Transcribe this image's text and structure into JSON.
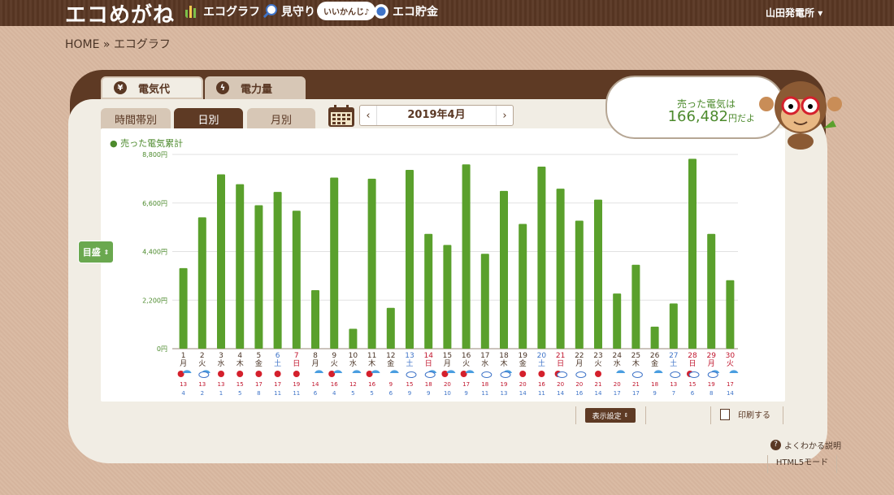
{
  "header": {
    "logo": "エコめがね",
    "nav": [
      {
        "label": "エコグラフ",
        "icon": "bar-chart-icon"
      },
      {
        "label": "見守り",
        "icon": "magnifier-icon"
      },
      {
        "label": "エコ貯金",
        "icon": "coin-icon"
      }
    ],
    "status_bubble": "いいかんじ♪",
    "user": "山田発電所"
  },
  "breadcrumb": "HOME » エコグラフ",
  "tabs": [
    {
      "label": "電気代",
      "icon": "yen-icon",
      "active": true
    },
    {
      "label": "電力量",
      "icon": "lightning-icon",
      "active": false
    }
  ],
  "subtabs": [
    {
      "label": "時間帯別",
      "active": false
    },
    {
      "label": "日別",
      "active": true
    },
    {
      "label": "月別",
      "active": false
    }
  ],
  "month_nav": {
    "prev": "‹",
    "label": "2019年4月",
    "next": "›"
  },
  "summary": {
    "line1": "売った電気は",
    "amount": "166,482",
    "unit": "円だよ"
  },
  "meyasu_label": "目盛",
  "buttons": {
    "display_settings": "表示設定",
    "print": "印刷する"
  },
  "footer": {
    "help": "よくわかる説明",
    "html5": "HTML5モード"
  },
  "colors": {
    "bar": "#5aa02c",
    "sunday": "#c0142c",
    "saturday": "#3f74c8",
    "weekday": "#4a3426",
    "header": "#5a3824"
  },
  "chart_data": {
    "type": "bar",
    "legend": "売った電気累計",
    "ylim": [
      0,
      8800
    ],
    "yticks": [
      "0円",
      "2,200円",
      "4,400円",
      "6,600円",
      "8,800円"
    ],
    "ytick_values": [
      0,
      2200,
      4400,
      6600,
      8800
    ],
    "days": [
      "1",
      "2",
      "3",
      "4",
      "5",
      "6",
      "7",
      "8",
      "9",
      "10",
      "11",
      "12",
      "13",
      "14",
      "15",
      "16",
      "17",
      "18",
      "19",
      "20",
      "21",
      "22",
      "23",
      "24",
      "25",
      "26",
      "27",
      "28",
      "29",
      "30"
    ],
    "weekdays": [
      "月",
      "火",
      "水",
      "木",
      "金",
      "土",
      "日",
      "月",
      "火",
      "水",
      "木",
      "金",
      "土",
      "日",
      "月",
      "火",
      "水",
      "木",
      "金",
      "土",
      "日",
      "月",
      "火",
      "水",
      "木",
      "金",
      "土",
      "日",
      "月",
      "火"
    ],
    "day_colors": [
      "weekday",
      "weekday",
      "weekday",
      "weekday",
      "weekday",
      "saturday",
      "sunday",
      "weekday",
      "weekday",
      "weekday",
      "weekday",
      "weekday",
      "saturday",
      "sunday",
      "weekday",
      "weekday",
      "weekday",
      "weekday",
      "weekday",
      "saturday",
      "sunday",
      "weekday",
      "weekday",
      "weekday",
      "weekday",
      "weekday",
      "saturday",
      "sunday",
      "sunday",
      "sunday"
    ],
    "values": [
      3650,
      5950,
      7900,
      7450,
      6500,
      7100,
      6250,
      2650,
      7750,
      900,
      7700,
      1850,
      8100,
      5200,
      4700,
      8350,
      4300,
      7150,
      5650,
      8250,
      7250,
      5800,
      6750,
      2500,
      3800,
      1000,
      2050,
      8600,
      5200,
      3100
    ],
    "weather": [
      "sunny-rain",
      "rain-cloud",
      "sunny",
      "sunny",
      "sunny",
      "sunny",
      "sunny",
      "rain",
      "sunny-rain",
      "rain",
      "sunny-rain",
      "rain",
      "cloud",
      "cloud-rain",
      "rain-sun",
      "sunny-rain",
      "cloud",
      "cloud-rain",
      "sunny",
      "sunny",
      "sunny-cloud",
      "cloud-sun",
      "sunny",
      "rain",
      "cloud",
      "rain",
      "cloud",
      "sunny-cloud",
      "cloud-rain",
      "rain"
    ],
    "high_temps": [
      "13",
      "13",
      "13",
      "15",
      "17",
      "17",
      "19",
      "14",
      "16",
      "12",
      "16",
      "9",
      "15",
      "18",
      "20",
      "17",
      "18",
      "19",
      "20",
      "16",
      "20",
      "20",
      "21",
      "20",
      "21",
      "18",
      "13",
      "15",
      "19",
      "17"
    ],
    "low_temps": [
      "4",
      "2",
      "1",
      "5",
      "8",
      "11",
      "11",
      "6",
      "4",
      "5",
      "5",
      "6",
      "9",
      "9",
      "10",
      "9",
      "11",
      "13",
      "14",
      "11",
      "14",
      "16",
      "14",
      "17",
      "17",
      "9",
      "7",
      "6",
      "8",
      "14"
    ]
  }
}
